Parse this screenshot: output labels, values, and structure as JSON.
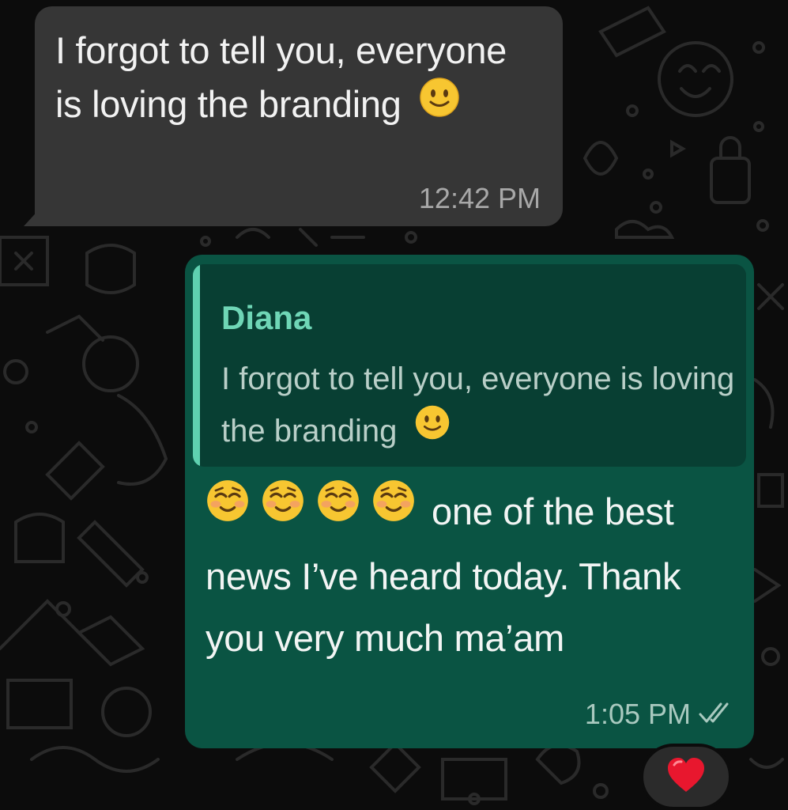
{
  "colors": {
    "incoming_bubble": "#363636",
    "outgoing_bubble": "#0a5443",
    "quote_bg": "#083f33",
    "quote_accent": "#5fd1b0",
    "read_ticks": "#a9c9bf"
  },
  "incoming": {
    "text": "I forgot to tell you, everyone is loving the branding",
    "emoji": "slightly-smiling-face",
    "time": "12:42 PM"
  },
  "outgoing": {
    "quote": {
      "author": "Diana",
      "text": "I forgot to tell you, everyone is loving the branding",
      "emoji": "slightly-smiling-face"
    },
    "emojis": [
      "smiling-face",
      "smiling-face",
      "smiling-face",
      "smiling-face"
    ],
    "text": "one of the best news I’ve heard today. Thank you very much ma’am",
    "time": "1:05 PM",
    "status_icon": "double-check-icon",
    "reaction": "red-heart"
  }
}
